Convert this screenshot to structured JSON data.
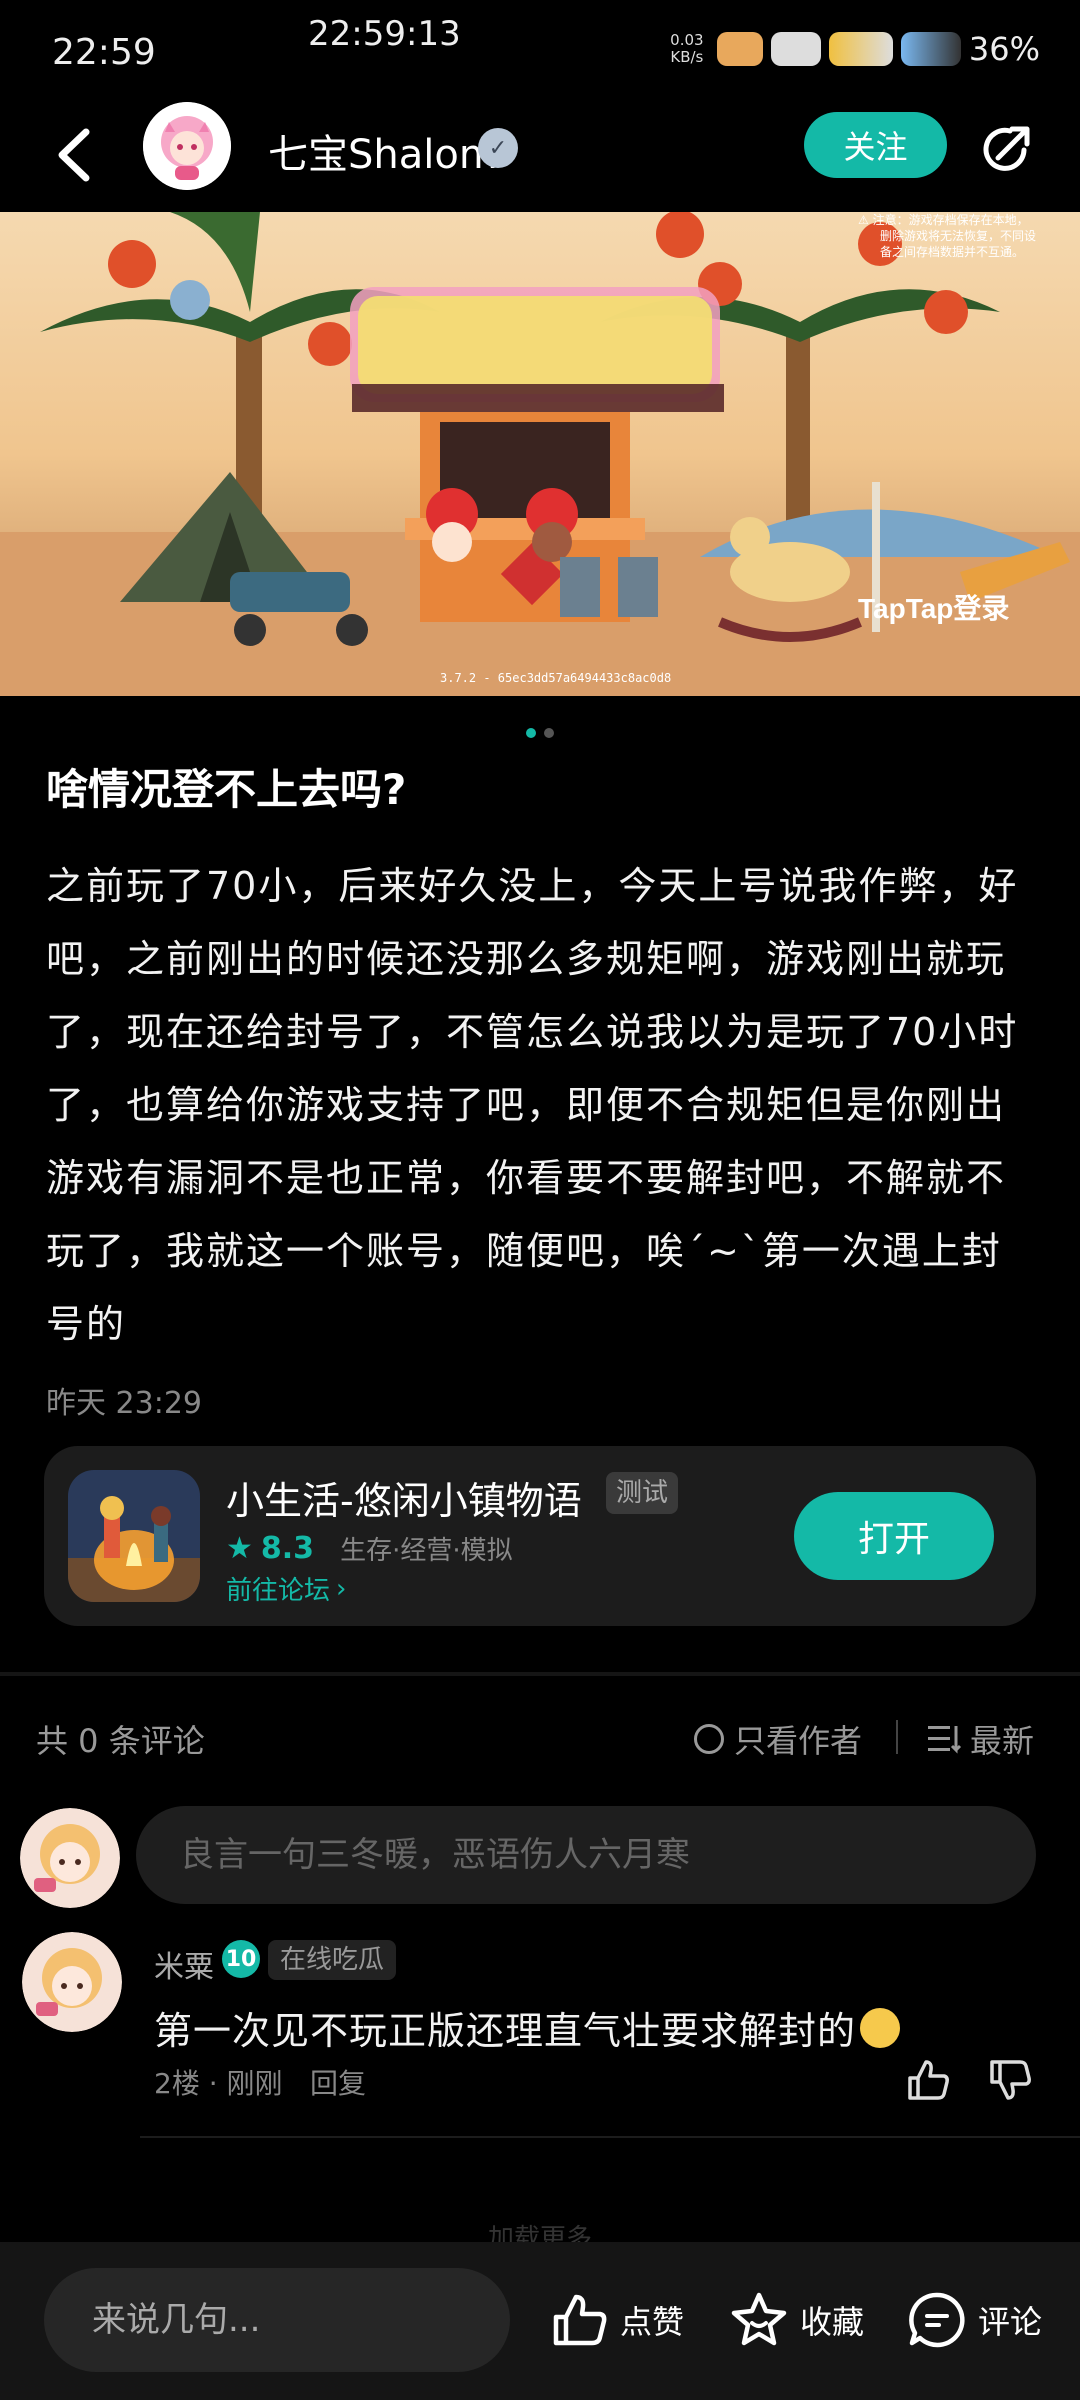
{
  "status_bar": {
    "time": "22:59",
    "clock": "22:59:13",
    "net_speed": "0.03 KB/s",
    "battery": "36%"
  },
  "header": {
    "author_name": "七宝Shalom",
    "follow_label": "关注"
  },
  "banner": {
    "slide_count": 2,
    "active_slide": 1
  },
  "post": {
    "title": "啥情况登不上去吗?",
    "body": "之前玩了70小，后来好久没上，今天上号说我作弊，好吧，之前刚出的时候还没那么多规矩啊，游戏刚出就玩了，现在还给封号了，不管怎么说我以为是玩了70小时了，也算给你游戏支持了吧，即便不合规矩但是你刚出游戏有漏洞不是也正常，你看要不要解封吧，不解就不玩了，我就这一个账号，随便吧，唉ˊ~ˋ第一次遇上封号的",
    "time": "昨天 23:29"
  },
  "game_card": {
    "name": "小生活-悠闲小镇物语",
    "tag": "测试",
    "rating": "8.3",
    "genres": "生存·经营·模拟",
    "forum_link": "前往论坛",
    "open_label": "打开"
  },
  "comments": {
    "count_label": "共 0 条评论",
    "author_only_label": "只看作者",
    "sort_label": "最新",
    "input_placeholder": "良言一句三冬暖，恶语伤人六月寒",
    "items": [
      {
        "user": "米粟",
        "level": "10",
        "tag": "在线吃瓜",
        "text": "第一次见不玩正版还理直气壮要求解封的",
        "meta": "2楼 · 刚刚",
        "reply_label": "回复"
      }
    ],
    "more_hint": "加载更多"
  },
  "bottom_bar": {
    "input_placeholder": "来说几句...",
    "like_label": "点赞",
    "favorite_label": "收藏",
    "comment_label": "评论"
  },
  "colors": {
    "accent": "#14b9a7",
    "background": "#000000",
    "card": "#1c1c1c"
  }
}
